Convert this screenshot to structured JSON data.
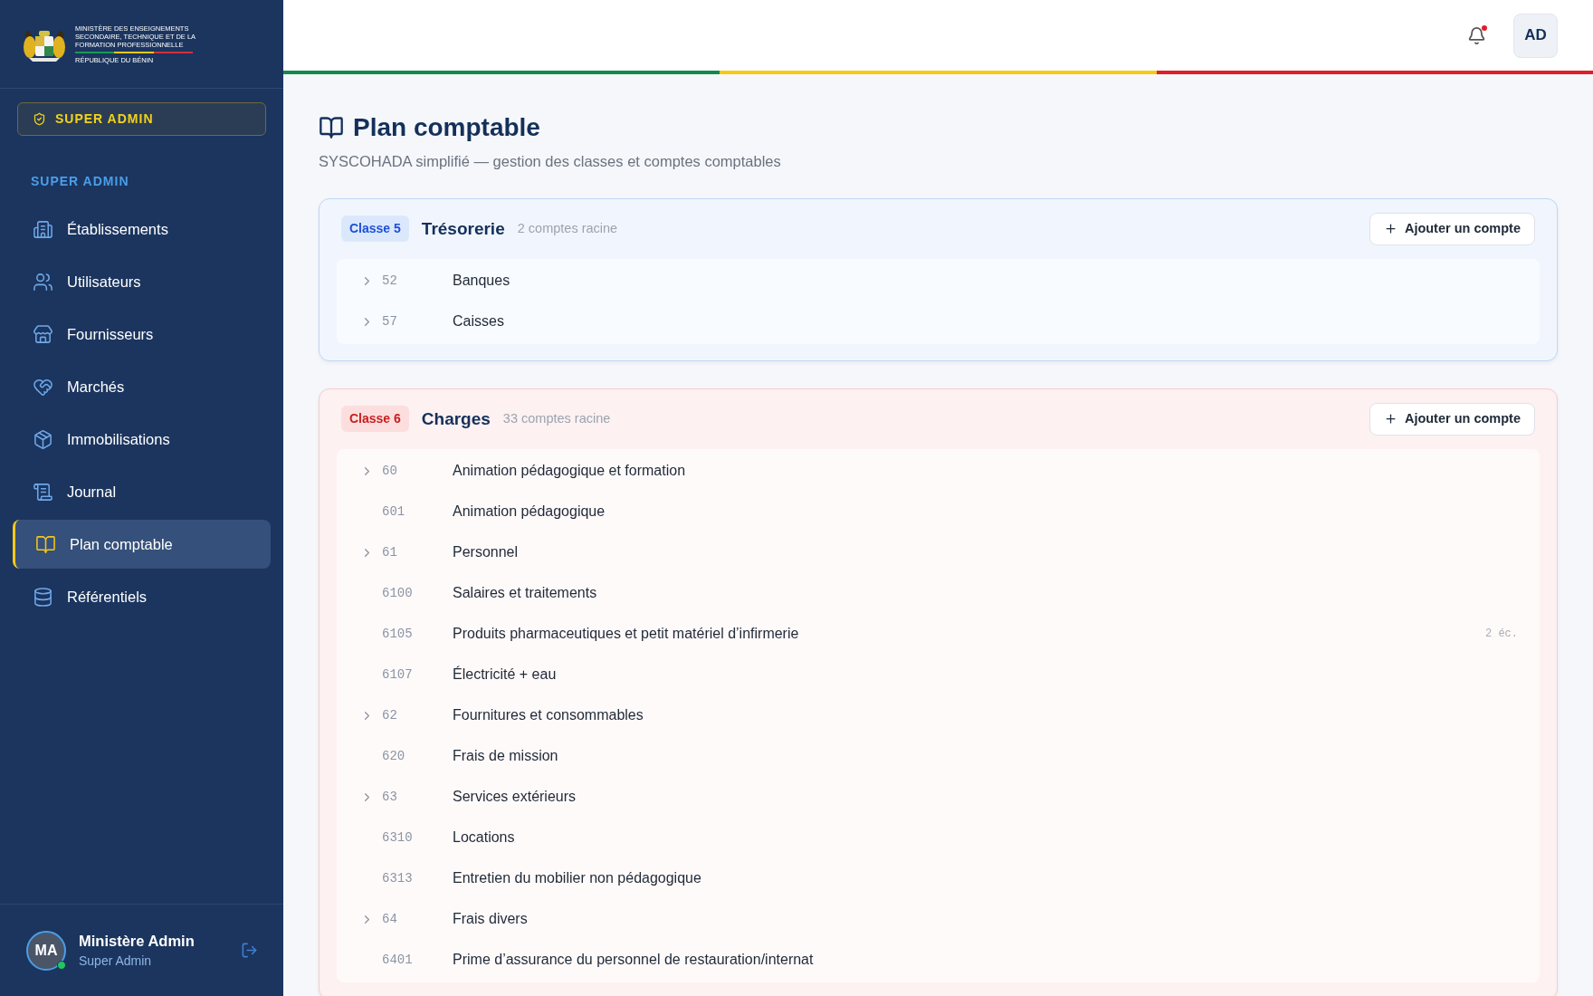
{
  "brand": {
    "lines": [
      "MINISTÈRE DES ENSEIGNEMENTS",
      "SECONDAIRE, TECHNIQUE ET DE LA",
      "FORMATION PROFESSIONNELLE"
    ],
    "country": "RÉPUBLIQUE DU BÉNIN"
  },
  "role_badge": "SUPER ADMIN",
  "section_label": "SUPER ADMIN",
  "nav": [
    {
      "label": "Établissements",
      "selected": false
    },
    {
      "label": "Utilisateurs",
      "selected": false
    },
    {
      "label": "Fournisseurs",
      "selected": false
    },
    {
      "label": "Marchés",
      "selected": false
    },
    {
      "label": "Immobilisations",
      "selected": false
    },
    {
      "label": "Journal",
      "selected": false
    },
    {
      "label": "Plan comptable",
      "selected": true
    },
    {
      "label": "Référentiels",
      "selected": false
    }
  ],
  "user": {
    "initials": "MA",
    "name": "Ministère Admin",
    "role": "Super Admin",
    "online": true
  },
  "header": {
    "notification": true,
    "avatar": "AD"
  },
  "page": {
    "title": "Plan comptable",
    "subtitle": "SYSCOHADA simplifié — gestion des classes et comptes comptables"
  },
  "classes": [
    {
      "badge": "Classe 5",
      "title": "Trésorerie",
      "count": "2 comptes racine",
      "button": "Ajouter un compte",
      "rows": [
        {
          "kind": "group",
          "code": "52",
          "label": "Banques"
        },
        {
          "kind": "group",
          "code": "57",
          "label": "Caisses"
        }
      ]
    },
    {
      "badge": "Classe 6",
      "title": "Charges",
      "count": "33 comptes racine",
      "button": "Ajouter un compte",
      "rows": [
        {
          "kind": "group",
          "code": "60",
          "label": "Animation pédagogique et formation"
        },
        {
          "kind": "account",
          "code": "601",
          "label": "Animation pédagogique"
        },
        {
          "kind": "group",
          "code": "61",
          "label": "Personnel"
        },
        {
          "kind": "account",
          "code": "6100",
          "label": "Salaires et traitements"
        },
        {
          "kind": "account",
          "code": "6105",
          "label": "Produits pharmaceutiques et petit matériel d’infirmerie",
          "note": "2 éc."
        },
        {
          "kind": "account",
          "code": "6107",
          "label": "Électricité + eau"
        },
        {
          "kind": "group",
          "code": "62",
          "label": "Fournitures et consommables"
        },
        {
          "kind": "account",
          "code": "620",
          "label": "Frais de mission"
        },
        {
          "kind": "group",
          "code": "63",
          "label": "Services extérieurs"
        },
        {
          "kind": "account",
          "code": "6310",
          "label": "Locations"
        },
        {
          "kind": "account",
          "code": "6313",
          "label": "Entretien du mobilier non pédagogique"
        },
        {
          "kind": "group",
          "code": "64",
          "label": "Frais divers"
        },
        {
          "kind": "account",
          "code": "6401",
          "label": "Prime d’assurance du personnel de restauration/internat"
        }
      ]
    }
  ]
}
